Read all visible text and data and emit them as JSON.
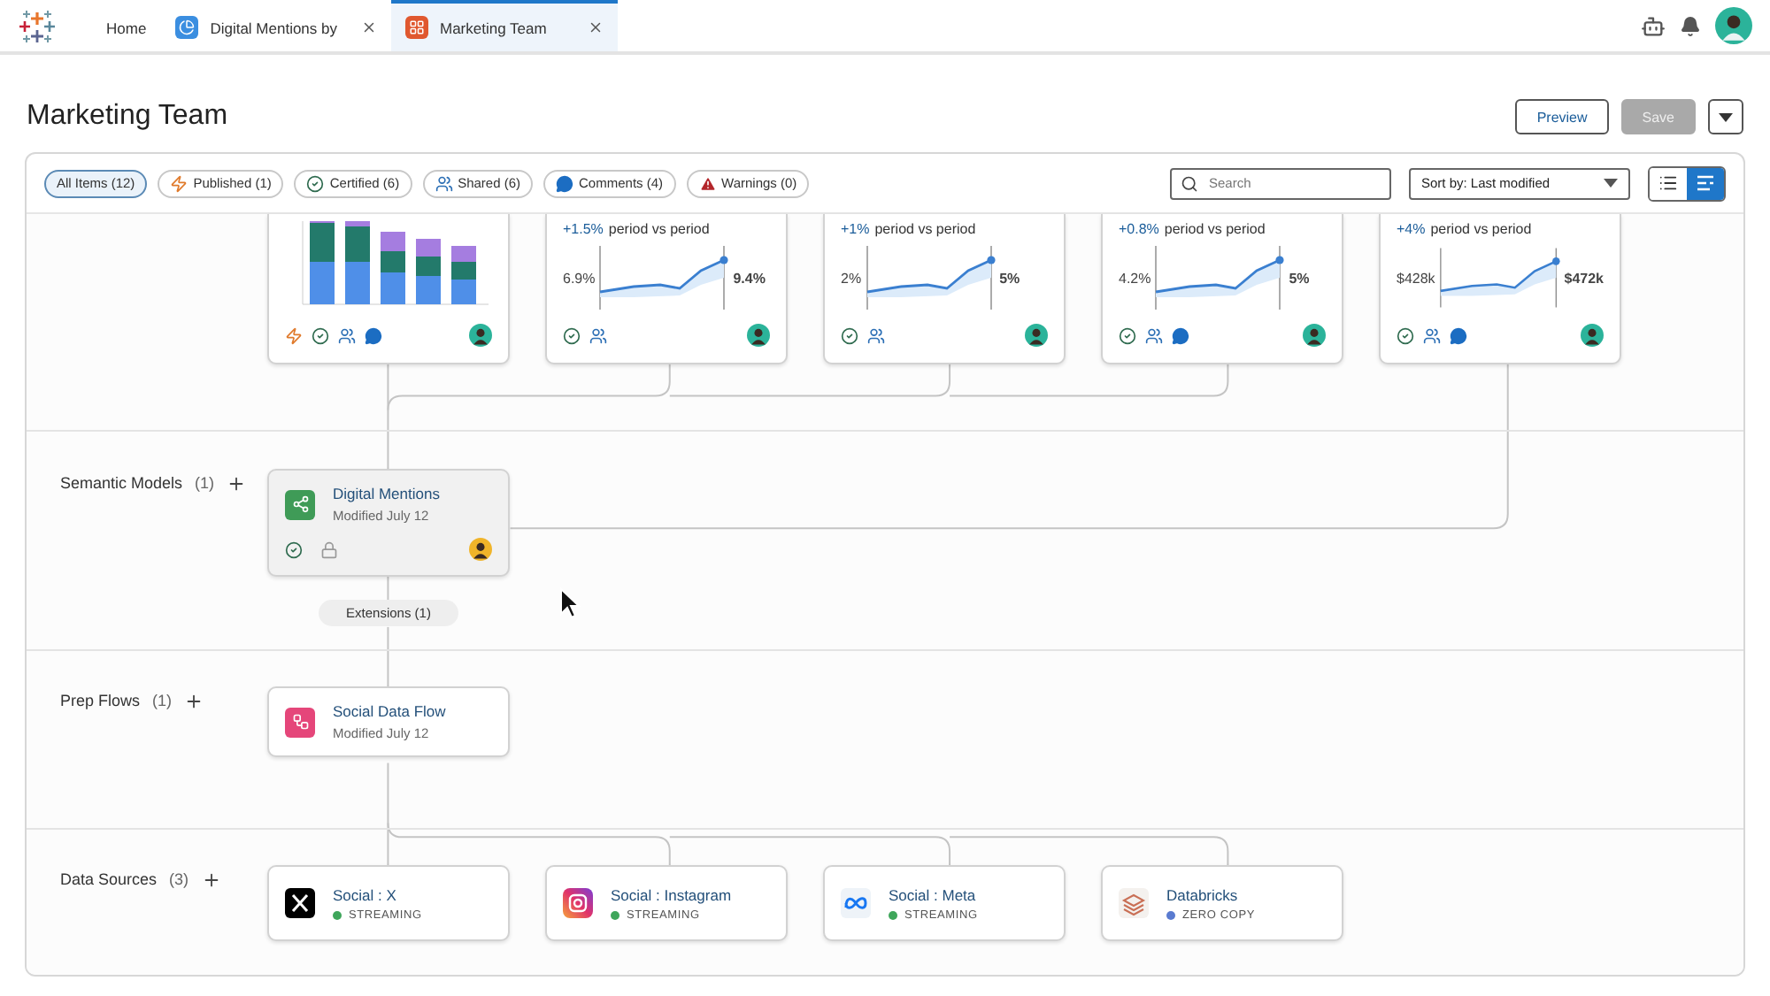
{
  "top_bar": {
    "tabs": [
      {
        "label": "Home",
        "kind": "home",
        "selected": false
      },
      {
        "label": "Digital Mentions by",
        "kind": "dashboard",
        "selected": false
      },
      {
        "label": "Marketing Team",
        "kind": "project",
        "selected": true
      }
    ]
  },
  "page": {
    "title": "Marketing Team",
    "buttons": [
      {
        "label": "Preview",
        "disabled": false
      },
      {
        "label": "Save",
        "disabled": true
      }
    ]
  },
  "filters": [
    {
      "label": "All Items (12)",
      "kind": "all",
      "selected": true
    },
    {
      "label": "Published (1)",
      "kind": "published",
      "selected": false
    },
    {
      "label": "Certified (6)",
      "kind": "certified",
      "selected": false
    },
    {
      "label": "Shared (6)",
      "kind": "shared",
      "selected": false
    },
    {
      "label": "Comments (4)",
      "kind": "comments",
      "selected": false
    },
    {
      "label": "Warnings (0)",
      "kind": "warnings",
      "selected": false
    }
  ],
  "search": {
    "placeholder": "Search"
  },
  "sort": {
    "value": "Sort by: Last modified"
  },
  "view_toggle": [
    {
      "kind": "list",
      "selected": false
    },
    {
      "kind": "lineage",
      "selected": true
    }
  ],
  "lanes": [
    {
      "kind": "views",
      "cards": [
        {
          "kind": "bars",
          "published": true,
          "certified": true,
          "shared": true,
          "comments": true,
          "selected": false
        },
        {
          "kind": "trend",
          "delta": "+1.5%",
          "caption": "period vs period",
          "start": "6.9%",
          "end": "9.4%",
          "published": false,
          "certified": true,
          "shared": true,
          "comments": false,
          "selected": false
        },
        {
          "kind": "trend",
          "delta": "+1%",
          "caption": "period vs period",
          "start": "2%",
          "end": "5%",
          "published": false,
          "certified": true,
          "shared": true,
          "comments": false,
          "selected": false
        },
        {
          "kind": "trend",
          "delta": "+0.8%",
          "caption": "period vs period",
          "start": "4.2%",
          "end": "5%",
          "published": false,
          "certified": true,
          "shared": true,
          "comments": true,
          "selected": false
        },
        {
          "kind": "trend",
          "delta": "+4%",
          "caption": "period vs period",
          "start": "$428k",
          "end": "$472k",
          "published": false,
          "certified": true,
          "shared": true,
          "comments": true,
          "selected": false
        }
      ]
    },
    {
      "kind": "models",
      "title": "Semantic Models",
      "count": "(1)",
      "extensions": "Extensions (1)",
      "cards": [
        {
          "kind": "item",
          "title": "Digital Mentions",
          "subtitle": "Modified July 12",
          "certified": true,
          "locked": true,
          "selected": true
        }
      ]
    },
    {
      "kind": "flows",
      "title": "Prep Flows",
      "count": "(1)",
      "cards": [
        {
          "kind": "item",
          "title": "Social Data Flow",
          "subtitle": "Modified July 12",
          "selected": false
        }
      ]
    },
    {
      "kind": "sources",
      "title": "Data Sources",
      "count": "(3)",
      "cards": [
        {
          "kind": "source",
          "title": "Social : X",
          "status": "STREAMING",
          "color": "#3fa65b",
          "selected": false
        },
        {
          "kind": "source",
          "title": "Social : Instagram",
          "status": "STREAMING",
          "color": "#3fa65b",
          "selected": false
        },
        {
          "kind": "source",
          "title": "Social : Meta",
          "status": "STREAMING",
          "color": "#3fa65b",
          "selected": false
        },
        {
          "kind": "source",
          "title": "Databricks",
          "status": "ZERO COPY",
          "color": "#5a7bd0",
          "selected": false
        }
      ]
    }
  ]
}
